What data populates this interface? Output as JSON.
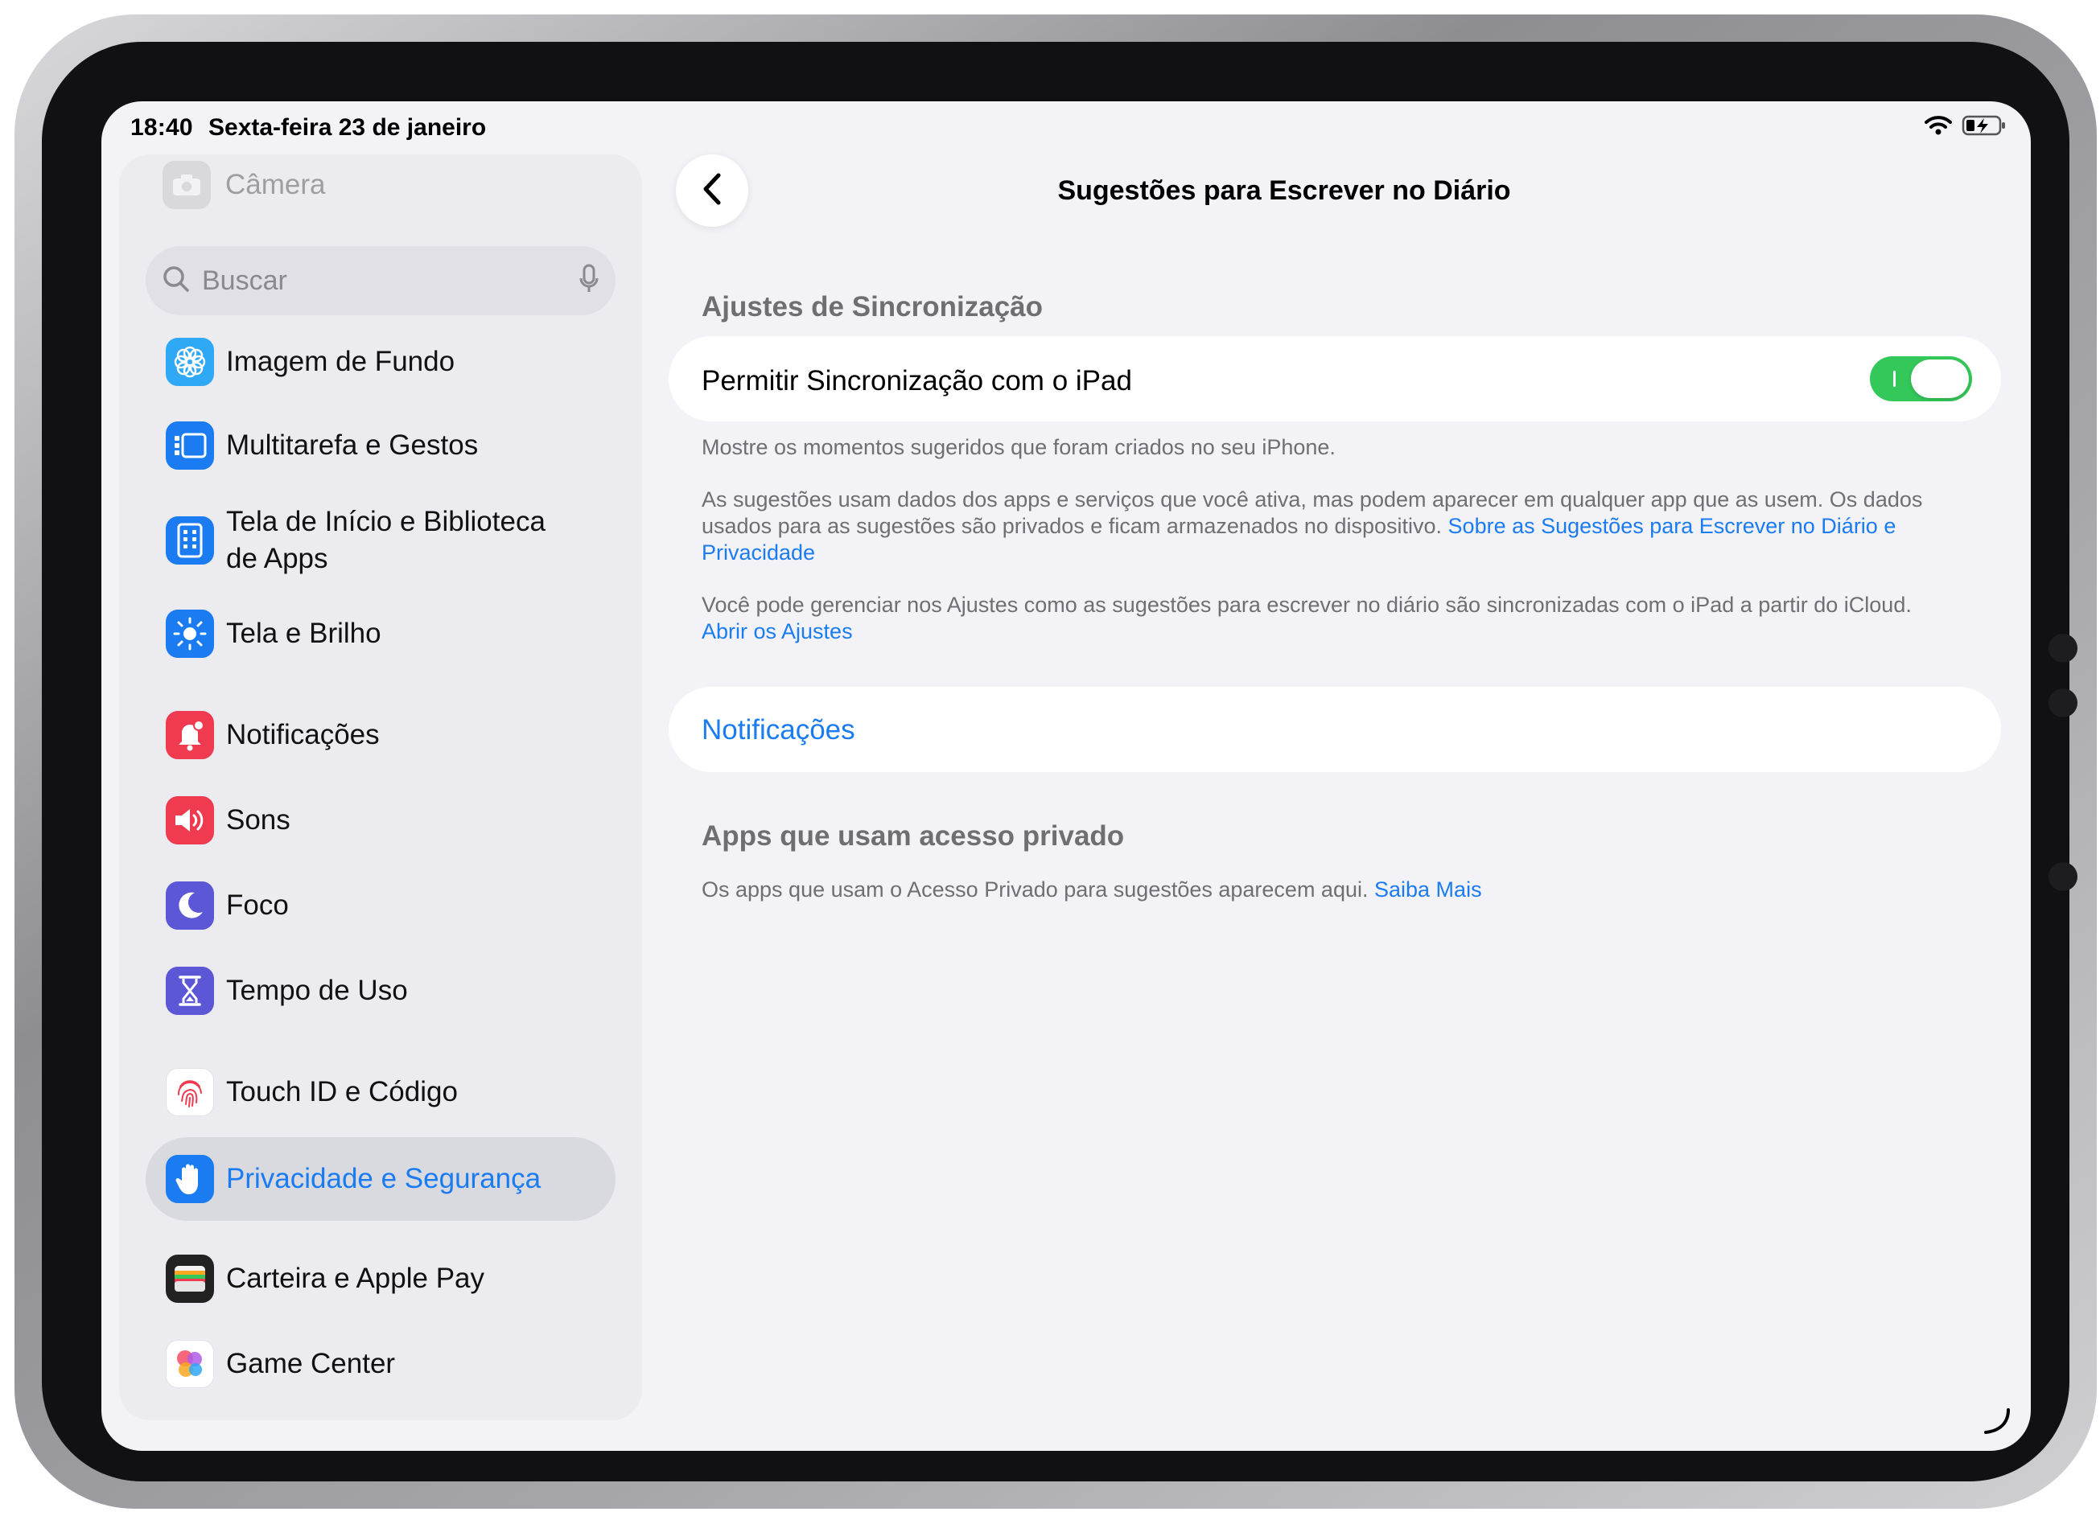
{
  "status_bar": {
    "time": "18:40",
    "date": "Sexta-feira 23 de janeiro",
    "icons": [
      "wifi-icon",
      "battery-charging-icon"
    ]
  },
  "sidebar": {
    "top_item": {
      "label": "Câmera",
      "icon": "camera-icon"
    },
    "search": {
      "placeholder": "Buscar",
      "icons": [
        "magnifier-icon",
        "microphone-icon"
      ]
    },
    "items": [
      {
        "label": "Imagem de Fundo",
        "icon": "wallpaper-flower-icon",
        "color": "#2fa8f5"
      },
      {
        "label": "Multitarefa e Gestos",
        "icon": "multitasking-icon",
        "color": "#1a7cf0"
      },
      {
        "label": "Tela de Início e Biblioteca de Apps",
        "icon": "home-screen-icon",
        "color": "#1a7cf0"
      },
      {
        "label": "Tela e Brilho",
        "icon": "sun-icon",
        "color": "#1a7cf0"
      },
      {
        "label": "Notificações",
        "icon": "bell-badge-icon",
        "color": "#f03a4f"
      },
      {
        "label": "Sons",
        "icon": "speaker-icon",
        "color": "#f03a4f"
      },
      {
        "label": "Foco",
        "icon": "moon-icon",
        "color": "#5b57d6"
      },
      {
        "label": "Tempo de Uso",
        "icon": "hourglass-icon",
        "color": "#5b57d6"
      },
      {
        "label": "Touch ID e Código",
        "icon": "fingerprint-icon",
        "color": "#ffffff"
      },
      {
        "label": "Privacidade e Segurança",
        "icon": "hand-icon",
        "color": "#1a7cf0",
        "selected": true
      },
      {
        "label": "Carteira e Apple Pay",
        "icon": "wallet-icon",
        "color": "#222222"
      },
      {
        "label": "Game Center",
        "icon": "game-center-icon",
        "color": "#ffffff"
      }
    ]
  },
  "header": {
    "back_icon": "chevron-left-icon",
    "title": "Sugestões para Escrever no Diário"
  },
  "sync_section": {
    "header": "Ajustes de Sincronização",
    "toggle_label": "Permitir Sincronização com o iPad",
    "toggle_on": true,
    "footnote1": "Mostre os momentos sugeridos que foram criados no seu iPhone.",
    "footnote2_text": "As sugestões usam dados dos apps e serviços que você ativa, mas podem aparecer em qualquer app que as usem. Os dados usados para as sugestões são privados e ficam armazenados no dispositivo.",
    "footnote2_link": "Sobre as Sugestões para Escrever no Diário e Privacidade",
    "footnote3_text": "Você pode gerenciar nos Ajustes como as sugestões para escrever no diário são sincronizadas com o iPad a partir do iCloud.",
    "footnote3_link": "Abrir os Ajustes"
  },
  "notifications_row": {
    "label": "Notificações"
  },
  "private_access_section": {
    "header": "Apps que usam acesso privado",
    "footnote_text": "Os apps que usam o Acesso Privado para sugestões aparecem aqui.",
    "footnote_link": "Saiba Mais"
  },
  "colors": {
    "accent": "#1a7cf0",
    "toggle_on": "#34c759",
    "background": "#f2f2f7",
    "sidebar": "#ebebf0"
  }
}
